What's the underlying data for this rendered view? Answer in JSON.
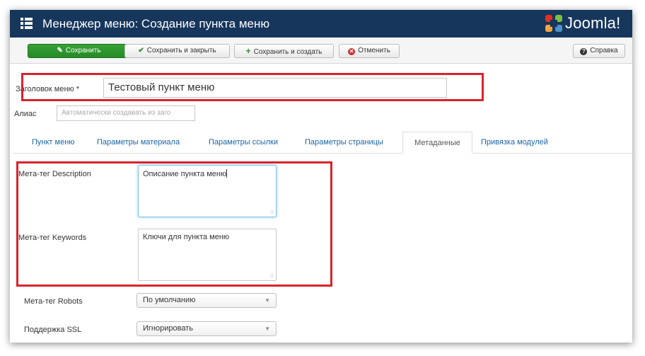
{
  "header": {
    "title": "Менеджер меню: Создание пункта меню",
    "brand": "Joomla!",
    "colors": {
      "bar": "#16365c",
      "logo_red": "#e42f25",
      "logo_green": "#7ac143",
      "logo_orange": "#f9a541",
      "logo_blue": "#5091cd"
    }
  },
  "toolbar": {
    "save": {
      "label": "Сохранить",
      "icon": "edit-icon"
    },
    "save_close": {
      "label": "Сохранить и закрыть",
      "icon": "check-icon"
    },
    "save_new": {
      "label": "Сохранить и создать",
      "icon": "plus-icon"
    },
    "cancel": {
      "label": "Отменить",
      "icon": "cancel-icon"
    },
    "help": {
      "label": "Справка",
      "icon": "question-icon"
    }
  },
  "form": {
    "title_label": "Заголовок меню *",
    "title_value": "Тестовый пункт меню",
    "alias_label": "Алиас",
    "alias_placeholder": "Автоматически создавать из заго"
  },
  "tabs": [
    {
      "label": "Пункт меню"
    },
    {
      "label": "Параметры материала"
    },
    {
      "label": "Параметры ссылки"
    },
    {
      "label": "Параметры страницы"
    },
    {
      "label": "Метаданные",
      "active": true
    },
    {
      "label": "Привязка модулей"
    }
  ],
  "metadata": {
    "description_label": "Мета-тег Description",
    "description_value": "Описание пункта меню",
    "keywords_label": "Мета-тег Keywords",
    "keywords_value": "Ключи для пункта меню",
    "robots_label": "Мета-тег Robots",
    "robots_value": "По умолчанию",
    "ssl_label": "Поддержка SSL",
    "ssl_value": "Игнорировать"
  },
  "highlight_color": "#d9232c"
}
